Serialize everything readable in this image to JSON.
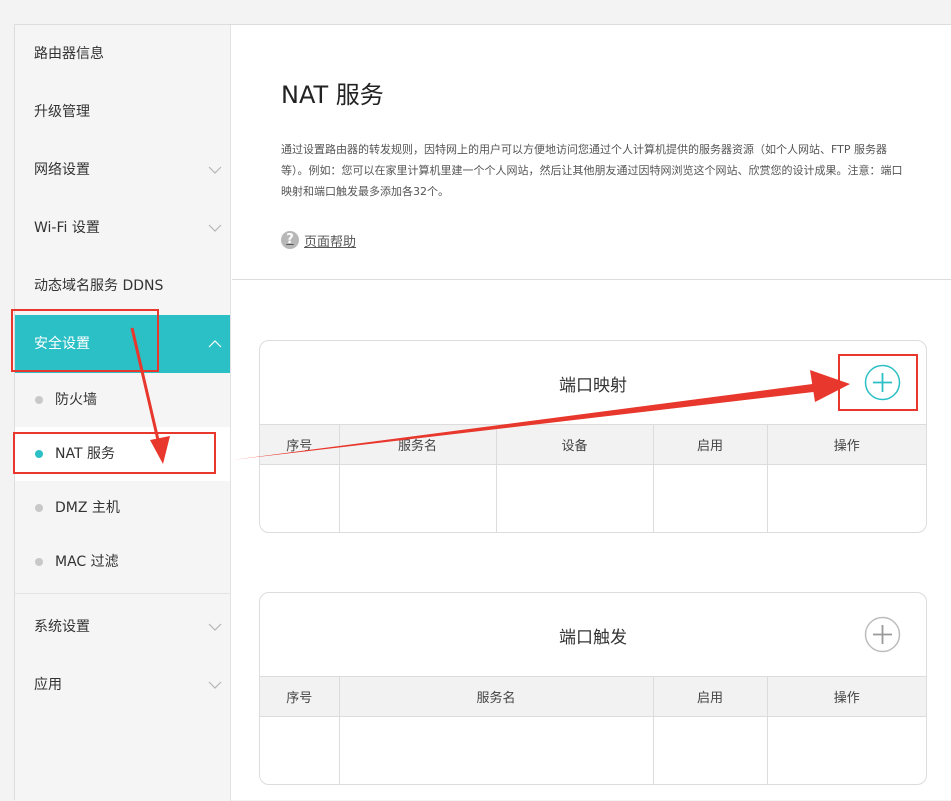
{
  "sidebar": {
    "items": [
      {
        "label": "路由器信息"
      },
      {
        "label": "升级管理"
      },
      {
        "label": "网络设置"
      },
      {
        "label": "Wi-Fi 设置"
      },
      {
        "label": "动态域名服务 DDNS"
      },
      {
        "label": "安全设置"
      },
      {
        "label": "系统设置"
      },
      {
        "label": "应用"
      }
    ],
    "security_sub": [
      {
        "label": "防火墙"
      },
      {
        "label": "NAT 服务"
      },
      {
        "label": "DMZ 主机"
      },
      {
        "label": "MAC 过滤"
      }
    ]
  },
  "main": {
    "title": "NAT 服务",
    "description": "通过设置路由器的转发规则，因特网上的用户可以方便地访问您通过个人计算机提供的服务器资源（如个人网站、FTP 服务器等）。例如：您可以在家里计算机里建一个个人网站，然后让其他朋友通过因特网浏览这个网站、欣赏您的设计成果。注意：端口映射和端口触发最多添加各32个。",
    "help_label": "页面帮助",
    "port_mapping": {
      "title": "端口映射",
      "columns": [
        "序号",
        "服务名",
        "设备",
        "启用",
        "操作"
      ]
    },
    "port_trigger": {
      "title": "端口触发",
      "columns": [
        "序号",
        "服务名",
        "启用",
        "操作"
      ]
    }
  },
  "colors": {
    "accent": "#2bbfc6",
    "annotation": "#e8372c"
  },
  "icons": {
    "chevron": "chevron-down-icon",
    "chevron_up": "chevron-up-icon",
    "help": "question-circle-icon",
    "add": "plus-circle-icon"
  }
}
